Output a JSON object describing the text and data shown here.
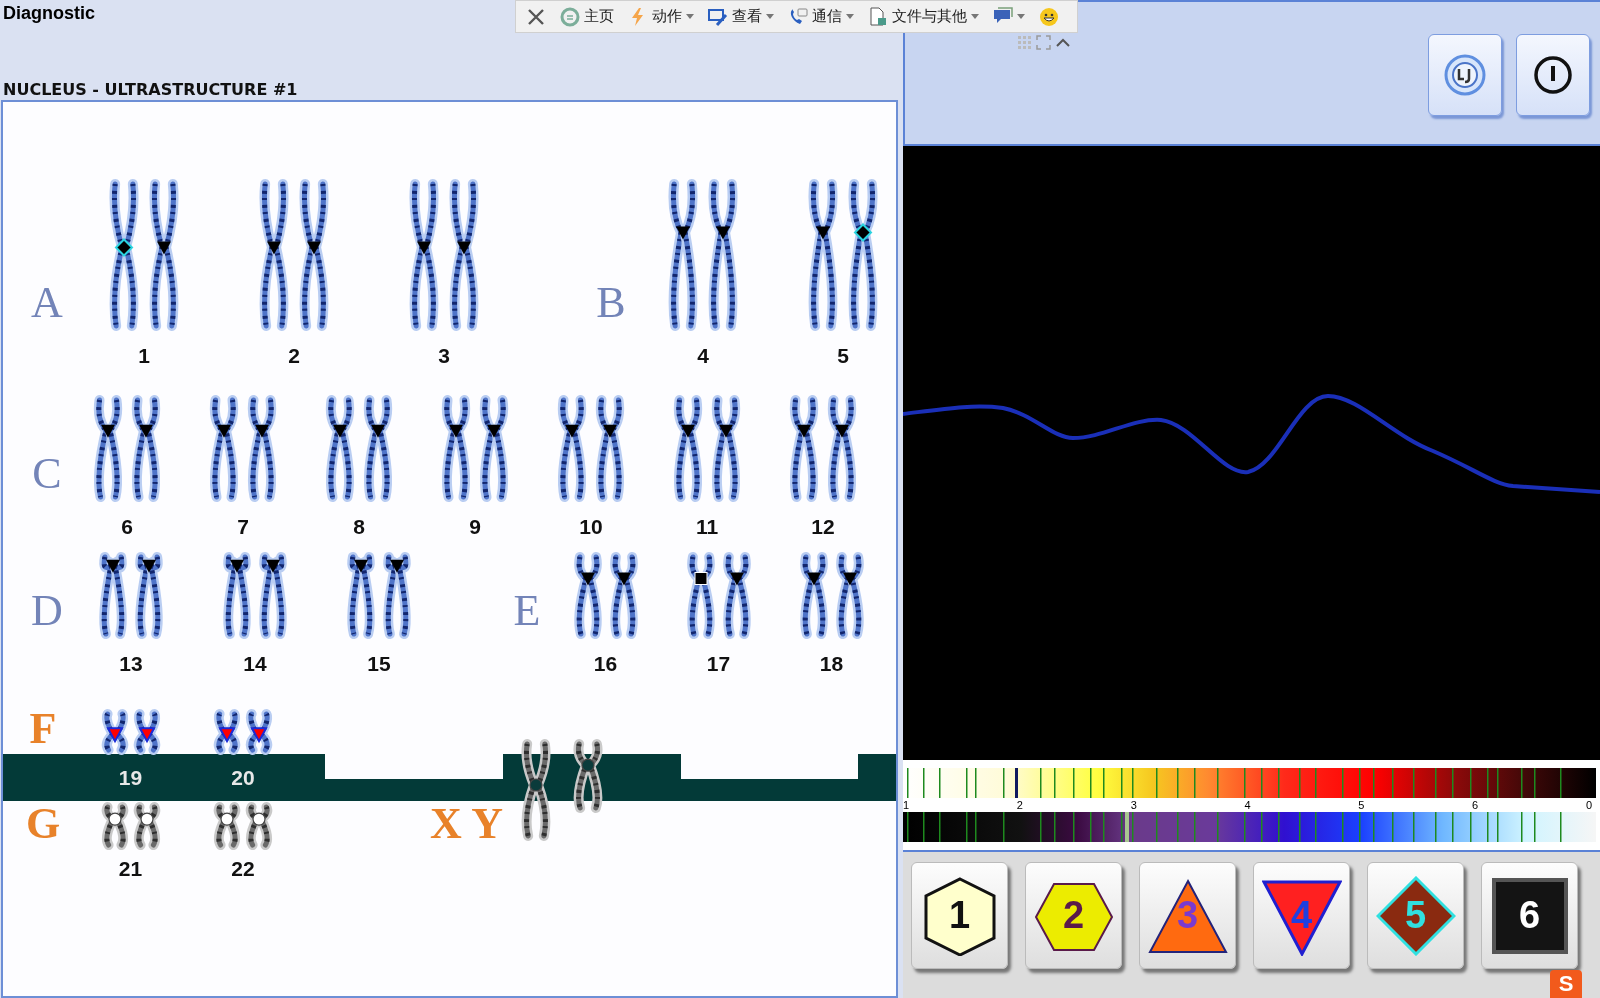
{
  "title": "Diagnostic",
  "toolbar": {
    "items": [
      {
        "kind": "close",
        "dropdown": false
      },
      {
        "kind": "home",
        "label": "主页",
        "dropdown": false
      },
      {
        "kind": "bolt",
        "label": "动作",
        "dropdown": true
      },
      {
        "kind": "view",
        "label": "查看",
        "dropdown": true
      },
      {
        "kind": "phone",
        "label": "通信",
        "dropdown": true
      },
      {
        "kind": "file",
        "label": "文件与其他",
        "dropdown": true
      },
      {
        "kind": "chat",
        "dropdown": true
      },
      {
        "kind": "smiley",
        "dropdown": false
      }
    ]
  },
  "section_title": "NUCLEUS - ULTRASTRUCTURE #1",
  "karyotype": {
    "rows": [
      {
        "groups": [
          {
            "letter": "A",
            "color": "#7384b8",
            "pairs": [
              {
                "number": "1",
                "markers": [
                  {
                    "kind": "diamond",
                    "color": "#000000"
                  },
                  {
                    "kind": "triangle",
                    "color": "#000000"
                  }
                ]
              },
              {
                "number": "2",
                "markers": [
                  {
                    "kind": "triangle",
                    "color": "#000000"
                  },
                  {
                    "kind": "triangle",
                    "color": "#000000"
                  }
                ]
              },
              {
                "number": "3",
                "markers": [
                  {
                    "kind": "triangle",
                    "color": "#000000"
                  },
                  {
                    "kind": "triangle",
                    "color": "#000000"
                  }
                ]
              }
            ]
          },
          {
            "letter": "B",
            "color": "#7384b8",
            "pairs": [
              {
                "number": "4",
                "markers": [
                  {
                    "kind": "triangle",
                    "color": "#000000"
                  },
                  {
                    "kind": "triangle",
                    "color": "#000000"
                  }
                ]
              },
              {
                "number": "5",
                "markers": [
                  {
                    "kind": "triangle",
                    "color": "#000000"
                  },
                  {
                    "kind": "diamond",
                    "color": "#000000"
                  }
                ]
              }
            ]
          }
        ]
      },
      {
        "groups": [
          {
            "letter": "C",
            "color": "#7384b8",
            "pairs": [
              {
                "number": "6",
                "markers": [
                  {
                    "kind": "triangle",
                    "color": "#000000"
                  },
                  {
                    "kind": "triangle",
                    "color": "#000000"
                  }
                ]
              },
              {
                "number": "7",
                "markers": [
                  {
                    "kind": "triangle",
                    "color": "#000000"
                  },
                  {
                    "kind": "triangle",
                    "color": "#000000"
                  }
                ]
              },
              {
                "number": "8",
                "markers": [
                  {
                    "kind": "triangle",
                    "color": "#000000"
                  },
                  {
                    "kind": "triangle",
                    "color": "#000000"
                  }
                ]
              },
              {
                "number": "9",
                "markers": [
                  {
                    "kind": "triangle",
                    "color": "#000000"
                  },
                  {
                    "kind": "triangle",
                    "color": "#000000"
                  }
                ]
              },
              {
                "number": "10",
                "markers": [
                  {
                    "kind": "triangle",
                    "color": "#000000"
                  },
                  {
                    "kind": "triangle",
                    "color": "#000000"
                  }
                ]
              },
              {
                "number": "11",
                "markers": [
                  {
                    "kind": "triangle",
                    "color": "#000000"
                  },
                  {
                    "kind": "triangle",
                    "color": "#000000"
                  }
                ]
              },
              {
                "number": "12",
                "markers": [
                  {
                    "kind": "triangle",
                    "color": "#000000"
                  },
                  {
                    "kind": "triangle",
                    "color": "#000000"
                  }
                ]
              }
            ]
          }
        ]
      },
      {
        "groups": [
          {
            "letter": "D",
            "color": "#7384b8",
            "pairs": [
              {
                "number": "13",
                "markers": [
                  {
                    "kind": "triangle",
                    "color": "#000000"
                  },
                  {
                    "kind": "triangle",
                    "color": "#000000"
                  }
                ]
              },
              {
                "number": "14",
                "markers": [
                  {
                    "kind": "triangle",
                    "color": "#000000"
                  },
                  {
                    "kind": "triangle",
                    "color": "#000000"
                  }
                ]
              },
              {
                "number": "15",
                "markers": [
                  {
                    "kind": "triangle",
                    "color": "#000000"
                  },
                  {
                    "kind": "triangle",
                    "color": "#000000"
                  }
                ]
              }
            ]
          },
          {
            "letter": "E",
            "color": "#7384b8",
            "pairs": [
              {
                "number": "16",
                "markers": [
                  {
                    "kind": "triangle",
                    "color": "#000000"
                  },
                  {
                    "kind": "triangle",
                    "color": "#000000"
                  }
                ]
              },
              {
                "number": "17",
                "markers": [
                  {
                    "kind": "square",
                    "color": "#000000"
                  },
                  {
                    "kind": "triangle",
                    "color": "#000000"
                  }
                ]
              },
              {
                "number": "18",
                "markers": [
                  {
                    "kind": "triangle",
                    "color": "#000000"
                  },
                  {
                    "kind": "triangle",
                    "color": "#000000"
                  }
                ]
              }
            ]
          }
        ]
      }
    ],
    "group_f": {
      "letter": "F",
      "color": "#e8822a",
      "pairs": [
        {
          "number": "19",
          "markers": [
            {
              "kind": "triangle",
              "color": "#ff0000"
            },
            {
              "kind": "triangle",
              "color": "#ff0000"
            }
          ]
        },
        {
          "number": "20",
          "markers": [
            {
              "kind": "triangle",
              "color": "#ff0000"
            },
            {
              "kind": "triangle",
              "color": "#ff0000"
            }
          ]
        }
      ]
    },
    "group_g": {
      "letter": "G",
      "color": "#e8822a",
      "pairs": [
        {
          "number": "21",
          "markers": [
            {
              "kind": "circle",
              "color": "#ffffff"
            },
            {
              "kind": "circle",
              "color": "#ffffff"
            }
          ]
        },
        {
          "number": "22",
          "markers": [
            {
              "kind": "circle",
              "color": "#ffffff"
            },
            {
              "kind": "circle",
              "color": "#ffffff"
            }
          ]
        }
      ]
    },
    "sex": {
      "label": "X Y",
      "color": "#e8822a",
      "markers": [
        {
          "kind": "circle",
          "color": "#0b3b3b"
        },
        {
          "kind": "circle",
          "color": "#0b3b3b"
        }
      ]
    }
  },
  "spectrum": {
    "scale": [
      "1",
      "2",
      "3",
      "4",
      "5",
      "6",
      "0"
    ]
  },
  "shape_buttons": [
    {
      "kind": "hexagon",
      "label": "1"
    },
    {
      "kind": "hexflat",
      "label": "2"
    },
    {
      "kind": "triangle",
      "label": "3"
    },
    {
      "kind": "invtriangle",
      "label": "4"
    },
    {
      "kind": "diamond",
      "label": "5"
    },
    {
      "kind": "square",
      "label": "6"
    }
  ],
  "ime_badge": "S"
}
